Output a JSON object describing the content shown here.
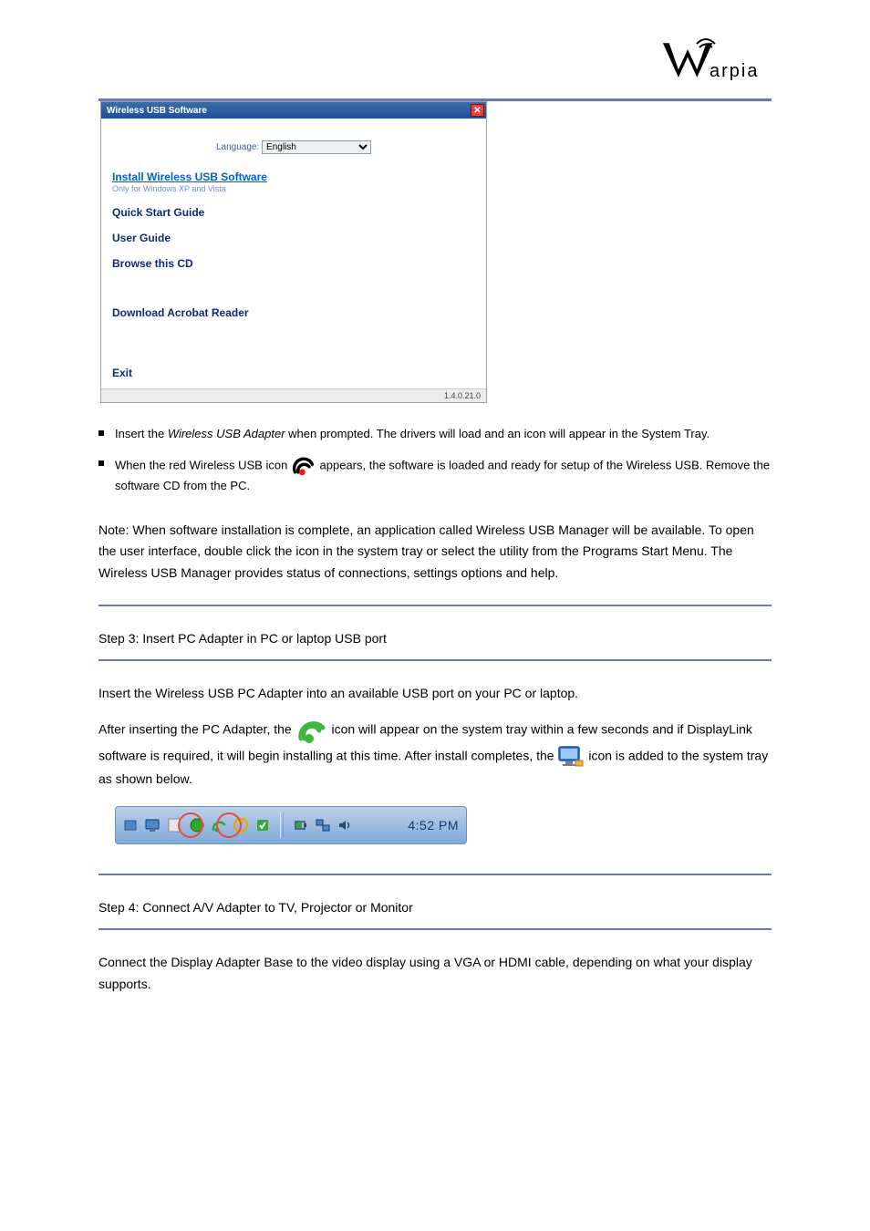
{
  "brand": {
    "name": "Warpia"
  },
  "installer": {
    "title": "Wireless USB Software",
    "language_label": "Language:",
    "language_value": "English",
    "install_link": "Install Wireless USB Software",
    "install_sub": "Only for Windows XP and Vista",
    "quick_start": "Quick Start Guide",
    "user_guide": "User Guide",
    "browse_cd": "Browse this CD",
    "download_reader": "Download Acrobat Reader",
    "exit": "Exit",
    "version": "1.4.0.21.0"
  },
  "steps": {
    "bullet1_pre": "Insert the ",
    "bullet1_em": "Wireless USB Adapter",
    "bullet1_post": " when prompted. The drivers will load and an icon will appear in the System Tray.",
    "bullet2_pre": "When the red Wireless USB icon ",
    "bullet2_post": " appears, the software is loaded and ready for setup of the Wireless USB. Remove the software CD from the PC."
  },
  "note1": "Note:   When software installation is complete, an application called Wireless USB Manager will be available. To open the user interface, double click the icon in the system tray or select the utility from the Programs Start Menu. The Wireless USB Manager provides status of connections, settings options and help.",
  "step3_title": "Step 3:   Insert PC Adapter in PC or laptop USB port",
  "step3_body": "Insert the Wireless USB PC Adapter into an available USB port on your PC or laptop.",
  "step3_b2_a": "After inserting the PC Adapter, the",
  "step3_b2_b": "icon will appear on the system tray within a few seconds and if DisplayLink software is required, it will begin installing at this time. After install completes, the",
  "step3_b2_c": "icon is added to the system tray as shown below.",
  "step4_title": "Step 4:  Connect A/V Adapter to TV, Projector or Monitor",
  "step4_body": "Connect the Display Adapter Base to the video display using a VGA or HDMI cable, depending on what your display supports.",
  "taskbar": {
    "time": "4:52 PM"
  }
}
